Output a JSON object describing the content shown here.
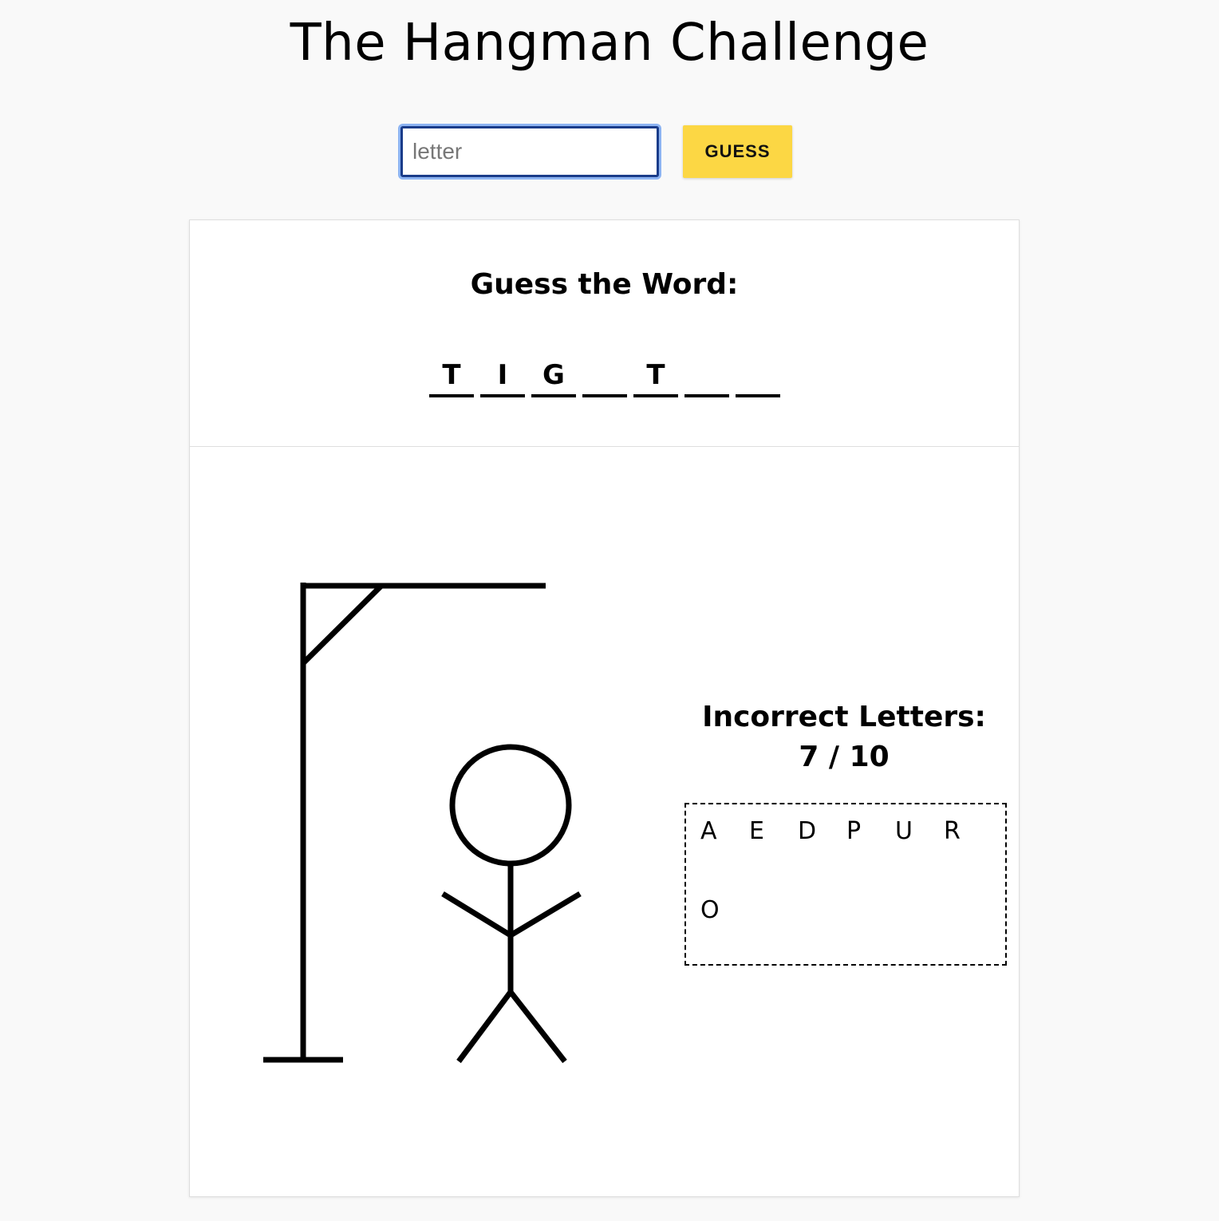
{
  "page": {
    "title": "The Hangman Challenge"
  },
  "form": {
    "input_placeholder": "letter",
    "input_value": "",
    "button_label": "GUESS"
  },
  "word": {
    "heading": "Guess the Word:",
    "slots": [
      "T",
      "I",
      "G",
      "",
      "T",
      "",
      ""
    ]
  },
  "incorrect": {
    "heading": "Incorrect Letters:",
    "count_text": "7 / 10",
    "letters": [
      "A",
      "E",
      "D",
      "P",
      "U",
      "R",
      "O"
    ]
  },
  "colors": {
    "background": "#f9f9f9",
    "button": "#fcd744",
    "input_border": "#1a3c8a",
    "input_focus_ring": "#8db4f2"
  }
}
